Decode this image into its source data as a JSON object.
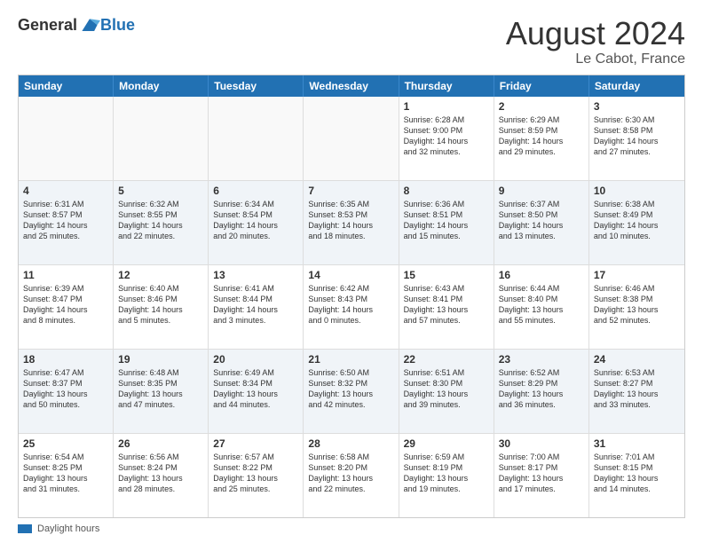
{
  "logo": {
    "general": "General",
    "blue": "Blue"
  },
  "title": "August 2024",
  "subtitle": "Le Cabot, France",
  "header_days": [
    "Sunday",
    "Monday",
    "Tuesday",
    "Wednesday",
    "Thursday",
    "Friday",
    "Saturday"
  ],
  "weeks": [
    [
      {
        "day": "",
        "info": "",
        "empty": true
      },
      {
        "day": "",
        "info": "",
        "empty": true
      },
      {
        "day": "",
        "info": "",
        "empty": true
      },
      {
        "day": "",
        "info": "",
        "empty": true
      },
      {
        "day": "1",
        "info": "Sunrise: 6:28 AM\nSunset: 9:00 PM\nDaylight: 14 hours\nand 32 minutes.",
        "empty": false
      },
      {
        "day": "2",
        "info": "Sunrise: 6:29 AM\nSunset: 8:59 PM\nDaylight: 14 hours\nand 29 minutes.",
        "empty": false
      },
      {
        "day": "3",
        "info": "Sunrise: 6:30 AM\nSunset: 8:58 PM\nDaylight: 14 hours\nand 27 minutes.",
        "empty": false
      }
    ],
    [
      {
        "day": "4",
        "info": "Sunrise: 6:31 AM\nSunset: 8:57 PM\nDaylight: 14 hours\nand 25 minutes.",
        "empty": false
      },
      {
        "day": "5",
        "info": "Sunrise: 6:32 AM\nSunset: 8:55 PM\nDaylight: 14 hours\nand 22 minutes.",
        "empty": false
      },
      {
        "day": "6",
        "info": "Sunrise: 6:34 AM\nSunset: 8:54 PM\nDaylight: 14 hours\nand 20 minutes.",
        "empty": false
      },
      {
        "day": "7",
        "info": "Sunrise: 6:35 AM\nSunset: 8:53 PM\nDaylight: 14 hours\nand 18 minutes.",
        "empty": false
      },
      {
        "day": "8",
        "info": "Sunrise: 6:36 AM\nSunset: 8:51 PM\nDaylight: 14 hours\nand 15 minutes.",
        "empty": false
      },
      {
        "day": "9",
        "info": "Sunrise: 6:37 AM\nSunset: 8:50 PM\nDaylight: 14 hours\nand 13 minutes.",
        "empty": false
      },
      {
        "day": "10",
        "info": "Sunrise: 6:38 AM\nSunset: 8:49 PM\nDaylight: 14 hours\nand 10 minutes.",
        "empty": false
      }
    ],
    [
      {
        "day": "11",
        "info": "Sunrise: 6:39 AM\nSunset: 8:47 PM\nDaylight: 14 hours\nand 8 minutes.",
        "empty": false
      },
      {
        "day": "12",
        "info": "Sunrise: 6:40 AM\nSunset: 8:46 PM\nDaylight: 14 hours\nand 5 minutes.",
        "empty": false
      },
      {
        "day": "13",
        "info": "Sunrise: 6:41 AM\nSunset: 8:44 PM\nDaylight: 14 hours\nand 3 minutes.",
        "empty": false
      },
      {
        "day": "14",
        "info": "Sunrise: 6:42 AM\nSunset: 8:43 PM\nDaylight: 14 hours\nand 0 minutes.",
        "empty": false
      },
      {
        "day": "15",
        "info": "Sunrise: 6:43 AM\nSunset: 8:41 PM\nDaylight: 13 hours\nand 57 minutes.",
        "empty": false
      },
      {
        "day": "16",
        "info": "Sunrise: 6:44 AM\nSunset: 8:40 PM\nDaylight: 13 hours\nand 55 minutes.",
        "empty": false
      },
      {
        "day": "17",
        "info": "Sunrise: 6:46 AM\nSunset: 8:38 PM\nDaylight: 13 hours\nand 52 minutes.",
        "empty": false
      }
    ],
    [
      {
        "day": "18",
        "info": "Sunrise: 6:47 AM\nSunset: 8:37 PM\nDaylight: 13 hours\nand 50 minutes.",
        "empty": false
      },
      {
        "day": "19",
        "info": "Sunrise: 6:48 AM\nSunset: 8:35 PM\nDaylight: 13 hours\nand 47 minutes.",
        "empty": false
      },
      {
        "day": "20",
        "info": "Sunrise: 6:49 AM\nSunset: 8:34 PM\nDaylight: 13 hours\nand 44 minutes.",
        "empty": false
      },
      {
        "day": "21",
        "info": "Sunrise: 6:50 AM\nSunset: 8:32 PM\nDaylight: 13 hours\nand 42 minutes.",
        "empty": false
      },
      {
        "day": "22",
        "info": "Sunrise: 6:51 AM\nSunset: 8:30 PM\nDaylight: 13 hours\nand 39 minutes.",
        "empty": false
      },
      {
        "day": "23",
        "info": "Sunrise: 6:52 AM\nSunset: 8:29 PM\nDaylight: 13 hours\nand 36 minutes.",
        "empty": false
      },
      {
        "day": "24",
        "info": "Sunrise: 6:53 AM\nSunset: 8:27 PM\nDaylight: 13 hours\nand 33 minutes.",
        "empty": false
      }
    ],
    [
      {
        "day": "25",
        "info": "Sunrise: 6:54 AM\nSunset: 8:25 PM\nDaylight: 13 hours\nand 31 minutes.",
        "empty": false
      },
      {
        "day": "26",
        "info": "Sunrise: 6:56 AM\nSunset: 8:24 PM\nDaylight: 13 hours\nand 28 minutes.",
        "empty": false
      },
      {
        "day": "27",
        "info": "Sunrise: 6:57 AM\nSunset: 8:22 PM\nDaylight: 13 hours\nand 25 minutes.",
        "empty": false
      },
      {
        "day": "28",
        "info": "Sunrise: 6:58 AM\nSunset: 8:20 PM\nDaylight: 13 hours\nand 22 minutes.",
        "empty": false
      },
      {
        "day": "29",
        "info": "Sunrise: 6:59 AM\nSunset: 8:19 PM\nDaylight: 13 hours\nand 19 minutes.",
        "empty": false
      },
      {
        "day": "30",
        "info": "Sunrise: 7:00 AM\nSunset: 8:17 PM\nDaylight: 13 hours\nand 17 minutes.",
        "empty": false
      },
      {
        "day": "31",
        "info": "Sunrise: 7:01 AM\nSunset: 8:15 PM\nDaylight: 13 hours\nand 14 minutes.",
        "empty": false
      }
    ]
  ],
  "footer": {
    "swatch_label": "Daylight hours"
  }
}
